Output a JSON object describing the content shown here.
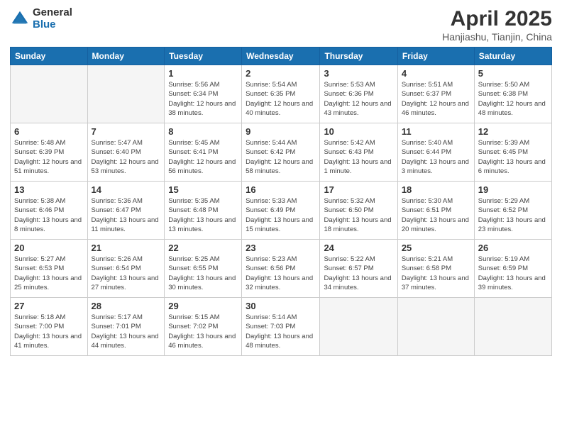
{
  "header": {
    "logo_general": "General",
    "logo_blue": "Blue",
    "month_title": "April 2025",
    "location": "Hanjiashu, Tianjin, China"
  },
  "weekdays": [
    "Sunday",
    "Monday",
    "Tuesday",
    "Wednesday",
    "Thursday",
    "Friday",
    "Saturday"
  ],
  "weeks": [
    [
      {
        "day": "",
        "info": ""
      },
      {
        "day": "",
        "info": ""
      },
      {
        "day": "1",
        "info": "Sunrise: 5:56 AM\nSunset: 6:34 PM\nDaylight: 12 hours and 38 minutes."
      },
      {
        "day": "2",
        "info": "Sunrise: 5:54 AM\nSunset: 6:35 PM\nDaylight: 12 hours and 40 minutes."
      },
      {
        "day": "3",
        "info": "Sunrise: 5:53 AM\nSunset: 6:36 PM\nDaylight: 12 hours and 43 minutes."
      },
      {
        "day": "4",
        "info": "Sunrise: 5:51 AM\nSunset: 6:37 PM\nDaylight: 12 hours and 46 minutes."
      },
      {
        "day": "5",
        "info": "Sunrise: 5:50 AM\nSunset: 6:38 PM\nDaylight: 12 hours and 48 minutes."
      }
    ],
    [
      {
        "day": "6",
        "info": "Sunrise: 5:48 AM\nSunset: 6:39 PM\nDaylight: 12 hours and 51 minutes."
      },
      {
        "day": "7",
        "info": "Sunrise: 5:47 AM\nSunset: 6:40 PM\nDaylight: 12 hours and 53 minutes."
      },
      {
        "day": "8",
        "info": "Sunrise: 5:45 AM\nSunset: 6:41 PM\nDaylight: 12 hours and 56 minutes."
      },
      {
        "day": "9",
        "info": "Sunrise: 5:44 AM\nSunset: 6:42 PM\nDaylight: 12 hours and 58 minutes."
      },
      {
        "day": "10",
        "info": "Sunrise: 5:42 AM\nSunset: 6:43 PM\nDaylight: 13 hours and 1 minute."
      },
      {
        "day": "11",
        "info": "Sunrise: 5:40 AM\nSunset: 6:44 PM\nDaylight: 13 hours and 3 minutes."
      },
      {
        "day": "12",
        "info": "Sunrise: 5:39 AM\nSunset: 6:45 PM\nDaylight: 13 hours and 6 minutes."
      }
    ],
    [
      {
        "day": "13",
        "info": "Sunrise: 5:38 AM\nSunset: 6:46 PM\nDaylight: 13 hours and 8 minutes."
      },
      {
        "day": "14",
        "info": "Sunrise: 5:36 AM\nSunset: 6:47 PM\nDaylight: 13 hours and 11 minutes."
      },
      {
        "day": "15",
        "info": "Sunrise: 5:35 AM\nSunset: 6:48 PM\nDaylight: 13 hours and 13 minutes."
      },
      {
        "day": "16",
        "info": "Sunrise: 5:33 AM\nSunset: 6:49 PM\nDaylight: 13 hours and 15 minutes."
      },
      {
        "day": "17",
        "info": "Sunrise: 5:32 AM\nSunset: 6:50 PM\nDaylight: 13 hours and 18 minutes."
      },
      {
        "day": "18",
        "info": "Sunrise: 5:30 AM\nSunset: 6:51 PM\nDaylight: 13 hours and 20 minutes."
      },
      {
        "day": "19",
        "info": "Sunrise: 5:29 AM\nSunset: 6:52 PM\nDaylight: 13 hours and 23 minutes."
      }
    ],
    [
      {
        "day": "20",
        "info": "Sunrise: 5:27 AM\nSunset: 6:53 PM\nDaylight: 13 hours and 25 minutes."
      },
      {
        "day": "21",
        "info": "Sunrise: 5:26 AM\nSunset: 6:54 PM\nDaylight: 13 hours and 27 minutes."
      },
      {
        "day": "22",
        "info": "Sunrise: 5:25 AM\nSunset: 6:55 PM\nDaylight: 13 hours and 30 minutes."
      },
      {
        "day": "23",
        "info": "Sunrise: 5:23 AM\nSunset: 6:56 PM\nDaylight: 13 hours and 32 minutes."
      },
      {
        "day": "24",
        "info": "Sunrise: 5:22 AM\nSunset: 6:57 PM\nDaylight: 13 hours and 34 minutes."
      },
      {
        "day": "25",
        "info": "Sunrise: 5:21 AM\nSunset: 6:58 PM\nDaylight: 13 hours and 37 minutes."
      },
      {
        "day": "26",
        "info": "Sunrise: 5:19 AM\nSunset: 6:59 PM\nDaylight: 13 hours and 39 minutes."
      }
    ],
    [
      {
        "day": "27",
        "info": "Sunrise: 5:18 AM\nSunset: 7:00 PM\nDaylight: 13 hours and 41 minutes."
      },
      {
        "day": "28",
        "info": "Sunrise: 5:17 AM\nSunset: 7:01 PM\nDaylight: 13 hours and 44 minutes."
      },
      {
        "day": "29",
        "info": "Sunrise: 5:15 AM\nSunset: 7:02 PM\nDaylight: 13 hours and 46 minutes."
      },
      {
        "day": "30",
        "info": "Sunrise: 5:14 AM\nSunset: 7:03 PM\nDaylight: 13 hours and 48 minutes."
      },
      {
        "day": "",
        "info": ""
      },
      {
        "day": "",
        "info": ""
      },
      {
        "day": "",
        "info": ""
      }
    ]
  ]
}
